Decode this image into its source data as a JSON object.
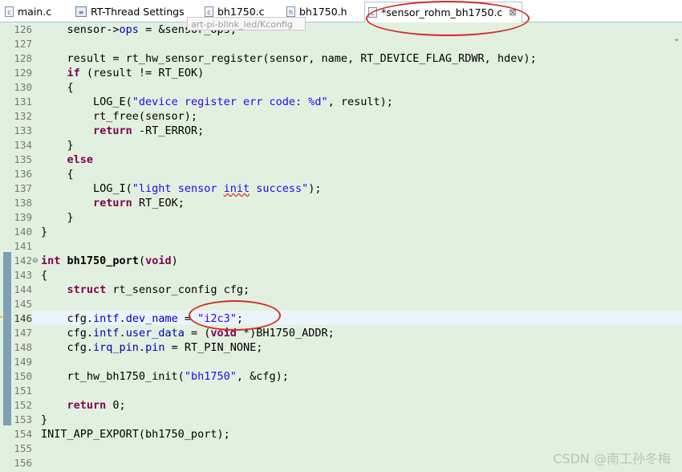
{
  "tabs": [
    {
      "label": "main.c",
      "icon": "c-file-icon",
      "icon_glyph": "c"
    },
    {
      "label": "RT-Thread Settings",
      "icon": "settings-file-icon",
      "icon_glyph": "≡"
    },
    {
      "label": "bh1750.c",
      "icon": "c-file-icon",
      "icon_glyph": "c"
    },
    {
      "label": "bh1750.h",
      "icon": "h-file-icon",
      "icon_glyph": "h"
    },
    {
      "label": "*sensor_rohm_bh1750.c",
      "icon": "c-file-icon",
      "icon_glyph": "c",
      "close": "⊠"
    }
  ],
  "tooltip": "art-pi-blink_led/Kconfig",
  "line_numbers": [
    "126",
    "127",
    "128",
    "129",
    "130",
    "131",
    "132",
    "133",
    "134",
    "135",
    "136",
    "137",
    "138",
    "139",
    "140",
    "141",
    "142",
    "143",
    "144",
    "145",
    "146",
    "147",
    "148",
    "149",
    "150",
    "151",
    "152",
    "153",
    "154",
    "155",
    "156"
  ],
  "current_line": "146",
  "watermark": "CSDN @南工孙冬梅",
  "colors": {
    "editor_bg": "#e2f1df",
    "keyword": "#7f0055",
    "field": "#0000c0",
    "string": "#2a00ff",
    "annotation": "#d62a2a"
  }
}
